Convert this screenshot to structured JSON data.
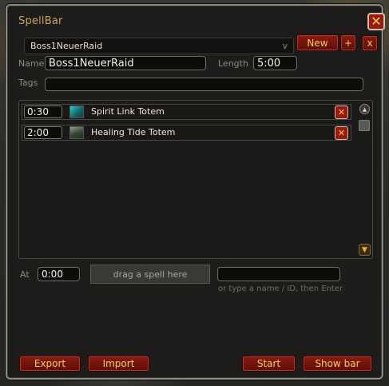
{
  "window": {
    "title": "SpellBar"
  },
  "header": {
    "raid_selected": "Boss1NeuerRaid",
    "dropdown_arrow": "v",
    "new_label": "New",
    "add_label": "+",
    "remove_label": "x"
  },
  "form": {
    "name_label": "Name",
    "name_value": "Boss1NeuerRaid",
    "length_label": "Length",
    "length_value": "5:00",
    "tags_label": "Tags",
    "tags_value": ""
  },
  "spells": [
    {
      "time": "0:30",
      "name": "Spirit Link Totem",
      "icon": "spirit-link-totem-icon"
    },
    {
      "time": "2:00",
      "name": "Healing Tide Totem",
      "icon": "healing-tide-totem-icon"
    }
  ],
  "add": {
    "at_label": "At",
    "at_value": "0:00",
    "drop_label": "drag a spell here",
    "search_value": "",
    "hint": "or type a name / ID, then Enter"
  },
  "footer": {
    "export_label": "Export",
    "import_label": "Import",
    "start_label": "Start",
    "show_bar_label": "Show bar"
  },
  "colors": {
    "title_gold": "#c8a75c",
    "button_red": "#8a1a10",
    "button_text": "#f0cf55"
  }
}
